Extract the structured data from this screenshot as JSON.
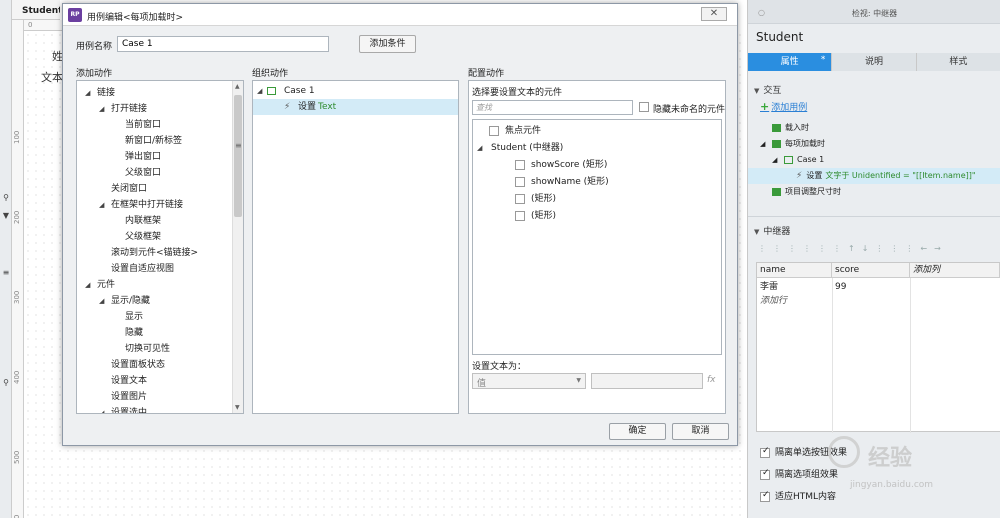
{
  "canvas": {
    "tab_title": "Student (",
    "ruler_top_label": "0",
    "ruler_left_labels": [
      "100",
      "200",
      "300",
      "400",
      "500",
      "600"
    ],
    "text_items": [
      "姓",
      "文本"
    ]
  },
  "dialog": {
    "title": "用例编辑<每项加载时>",
    "logo": "RP",
    "close_glyph": "✕",
    "case_name_label": "用例名称",
    "case_name_value": "Case 1",
    "add_condition_label": "添加条件",
    "add_actions_header": "添加动作",
    "organize_actions_header": "组织动作",
    "configure_actions_header": "配置动作",
    "add_actions_tree": [
      {
        "label": "链接",
        "level": 0,
        "expander": "◢"
      },
      {
        "label": "打开链接",
        "level": 1,
        "expander": "◢"
      },
      {
        "label": "当前窗口",
        "level": 2,
        "expander": ""
      },
      {
        "label": "新窗口/新标签",
        "level": 2,
        "expander": ""
      },
      {
        "label": "弹出窗口",
        "level": 2,
        "expander": ""
      },
      {
        "label": "父级窗口",
        "level": 2,
        "expander": ""
      },
      {
        "label": "关闭窗口",
        "level": 1,
        "expander": ""
      },
      {
        "label": "在框架中打开链接",
        "level": 1,
        "expander": "◢"
      },
      {
        "label": "内联框架",
        "level": 2,
        "expander": ""
      },
      {
        "label": "父级框架",
        "level": 2,
        "expander": ""
      },
      {
        "label": "滚动到元件<锚链接>",
        "level": 1,
        "expander": ""
      },
      {
        "label": "设置自适应视图",
        "level": 1,
        "expander": ""
      },
      {
        "label": "元件",
        "level": 0,
        "expander": "◢"
      },
      {
        "label": "显示/隐藏",
        "level": 1,
        "expander": "◢"
      },
      {
        "label": "显示",
        "level": 2,
        "expander": ""
      },
      {
        "label": "隐藏",
        "level": 2,
        "expander": ""
      },
      {
        "label": "切换可见性",
        "level": 2,
        "expander": ""
      },
      {
        "label": "设置面板状态",
        "level": 1,
        "expander": ""
      },
      {
        "label": "设置文本",
        "level": 1,
        "expander": ""
      },
      {
        "label": "设置图片",
        "level": 1,
        "expander": ""
      },
      {
        "label": "设置选中",
        "level": 1,
        "expander": "◢"
      }
    ],
    "organize": {
      "case_label": "Case 1",
      "action_prefix": "设置",
      "action_target": "Text"
    },
    "configure": {
      "select_widgets_label": "选择要设置文本的元件",
      "search_placeholder": "查找",
      "hide_unnamed_label": "隐藏未命名的元件",
      "widgets": [
        {
          "label": "焦点元件",
          "level": 0,
          "expander": "",
          "checkbox": true
        },
        {
          "label": "Student (中继器)",
          "level": 0,
          "expander": "◢",
          "checkbox": false
        },
        {
          "label": "showScore (矩形)",
          "level": 1,
          "expander": "",
          "checkbox": true
        },
        {
          "label": "showName (矩形)",
          "level": 1,
          "expander": "",
          "checkbox": true
        },
        {
          "label": "(矩形)",
          "level": 1,
          "expander": "",
          "checkbox": true
        },
        {
          "label": "(矩形)",
          "level": 1,
          "expander": "",
          "checkbox": true
        }
      ],
      "set_text_to_label": "设置文本为：",
      "value_select": "值",
      "value_input": "",
      "fx_label": "fx"
    },
    "ok_label": "确定",
    "cancel_label": "取消"
  },
  "inspector": {
    "header_title": "检视: 中继器",
    "widget_name": "Student",
    "tabs": [
      {
        "label": "属性",
        "active": true
      },
      {
        "label": "说明",
        "active": false
      },
      {
        "label": "样式",
        "active": false
      }
    ],
    "interaction_header": "交互",
    "add_case_label": "添加用例",
    "events": [
      {
        "kind": "event",
        "label": "载入时",
        "level": 0,
        "expander": "",
        "selected": false
      },
      {
        "kind": "event",
        "label": "每项加载时",
        "level": 0,
        "expander": "◢",
        "selected": false
      },
      {
        "kind": "case",
        "label": "Case 1",
        "level": 1,
        "expander": "◢",
        "selected": false
      },
      {
        "kind": "action",
        "label": "设置",
        "extra": "文字于 Unidentified = \"[[Item.name]]\"",
        "level": 2,
        "expander": "",
        "selected": true
      },
      {
        "kind": "event",
        "label": "项目调整尺寸时",
        "level": 0,
        "expander": "",
        "selected": false
      }
    ],
    "repeater_header": "中继器",
    "toolbar_glyphs": "⋮⋮⋮⋮⋮⋮↑↓⋮⋮⋮←→",
    "table": {
      "columns": [
        "name",
        "score",
        "添加列"
      ],
      "rows": [
        [
          "李雷",
          "99"
        ]
      ],
      "add_row_label": "添加行"
    },
    "options": [
      {
        "label": "隔离单选按钮效果",
        "checked": true
      },
      {
        "label": "隔离选项组效果",
        "checked": true
      },
      {
        "label": "适应HTML内容",
        "checked": true
      }
    ]
  },
  "watermark": {
    "text": "经验",
    "url": "jingyan.baidu.com"
  }
}
